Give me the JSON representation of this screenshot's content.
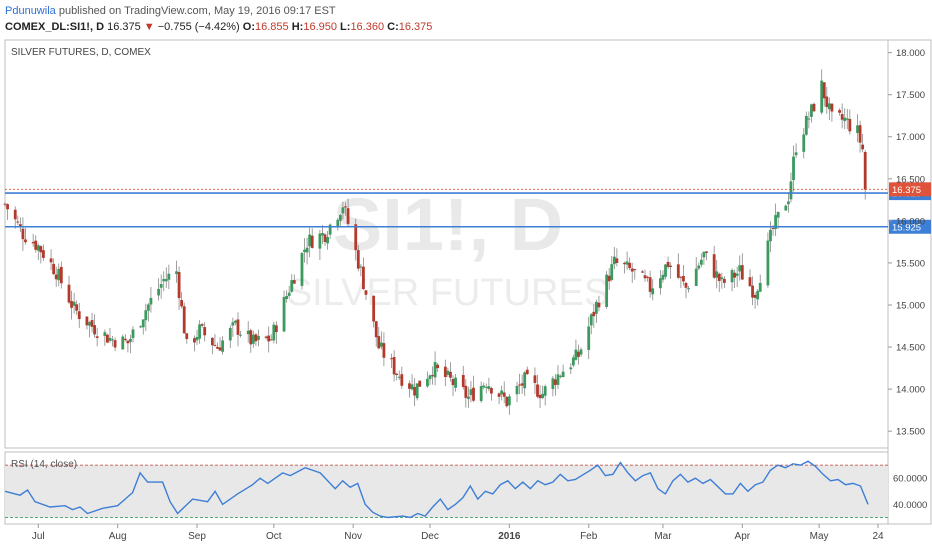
{
  "header": {
    "author": "Pdunuwila",
    "published": "published on TradingView.com, May 19, 2016 09:17 EST",
    "symbol": "COMEX_DL:SI1!, D",
    "last": "16.375",
    "change_arrow": "▼",
    "change": "−0.755 (−4.42%)",
    "o_label": "O:",
    "o_value": "16.855",
    "h_label": "H:",
    "h_value": "16.950",
    "l_label": "L:",
    "l_value": "16.360",
    "c_label": "C:",
    "c_value": "16.375"
  },
  "colors": {
    "up": "#3c9a5f",
    "down": "#b23a2c",
    "level_line": "#3d7ed6",
    "rsi_line": "#3d7ed6",
    "last_price": "#e0533b"
  },
  "chart_data": [
    {
      "type": "candlestick",
      "title": "SILVER FUTURES, D, COMEX",
      "watermark_symbol": "SI1!, D",
      "watermark_name": "SILVER FUTURES",
      "ylim": [
        13.3,
        18.15
      ],
      "yticks": [
        "13.500",
        "14.000",
        "14.500",
        "15.000",
        "15.500",
        "16.000",
        "16.500",
        "17.000",
        "17.500",
        "18.000"
      ],
      "xticks": [
        "Jul",
        "Aug",
        "Sep",
        "Oct",
        "Nov",
        "Dec",
        "2016",
        "Feb",
        "Mar",
        "Apr",
        "May",
        "24"
      ],
      "x_range": [
        "2015-06-18",
        "2016-05-24"
      ],
      "levels": [
        {
          "label": "16.325",
          "value": 16.33
        },
        {
          "label": "15.925",
          "value": 15.93
        }
      ],
      "last_price": {
        "label": "16.375",
        "value": 16.375
      },
      "close_path": [
        [
          "2015-06-18",
          16.2
        ],
        [
          "2015-06-25",
          15.85
        ],
        [
          "2015-07-01",
          15.7
        ],
        [
          "2015-07-08",
          15.4
        ],
        [
          "2015-07-15",
          14.95
        ],
        [
          "2015-07-22",
          14.75
        ],
        [
          "2015-07-29",
          14.6
        ],
        [
          "2015-08-05",
          14.55
        ],
        [
          "2015-08-12",
          14.95
        ],
        [
          "2015-08-19",
          15.3
        ],
        [
          "2015-08-24",
          15.4
        ],
        [
          "2015-08-28",
          14.5
        ],
        [
          "2015-09-02",
          14.7
        ],
        [
          "2015-09-09",
          14.5
        ],
        [
          "2015-09-16",
          14.75
        ],
        [
          "2015-09-23",
          14.55
        ],
        [
          "2015-09-30",
          14.6
        ],
        [
          "2015-10-07",
          15.2
        ],
        [
          "2015-10-14",
          15.75
        ],
        [
          "2015-10-21",
          15.85
        ],
        [
          "2015-10-28",
          16.2
        ],
        [
          "2015-11-04",
          15.4
        ],
        [
          "2015-11-11",
          14.5
        ],
        [
          "2015-11-18",
          14.2
        ],
        [
          "2015-11-25",
          14.0
        ],
        [
          "2015-12-02",
          14.25
        ],
        [
          "2015-12-09",
          14.1
        ],
        [
          "2015-12-16",
          13.9
        ],
        [
          "2015-12-23",
          14.1
        ],
        [
          "2015-12-31",
          13.85
        ],
        [
          "2016-01-07",
          14.1
        ],
        [
          "2016-01-14",
          13.95
        ],
        [
          "2016-01-21",
          14.2
        ],
        [
          "2016-01-28",
          14.4
        ],
        [
          "2016-02-04",
          15.0
        ],
        [
          "2016-02-11",
          15.5
        ],
        [
          "2016-02-18",
          15.4
        ],
        [
          "2016-02-25",
          15.2
        ],
        [
          "2016-03-03",
          15.5
        ],
        [
          "2016-03-10",
          15.2
        ],
        [
          "2016-03-17",
          15.6
        ],
        [
          "2016-03-24",
          15.25
        ],
        [
          "2016-03-31",
          15.4
        ],
        [
          "2016-04-06",
          15.15
        ],
        [
          "2016-04-13",
          15.9
        ],
        [
          "2016-04-19",
          16.3
        ],
        [
          "2016-04-22",
          16.9
        ],
        [
          "2016-04-28",
          17.3
        ],
        [
          "2016-05-02",
          17.6
        ],
        [
          "2016-05-06",
          17.2
        ],
        [
          "2016-05-11",
          17.2
        ],
        [
          "2016-05-16",
          17.05
        ],
        [
          "2016-05-18",
          16.85
        ],
        [
          "2016-05-19",
          16.375
        ]
      ],
      "volatility": 0.13
    },
    {
      "type": "line",
      "title": "RSI (14, close)",
      "ylim": [
        25,
        80
      ],
      "yticks": [
        "40.0000",
        "60.0000"
      ],
      "bands": [
        70,
        30
      ],
      "series": [
        {
          "values": [
            [
              0,
              50
            ],
            [
              2,
              47
            ],
            [
              3,
              51
            ],
            [
              4,
              42
            ],
            [
              6,
              38
            ],
            [
              8,
              39
            ],
            [
              9,
              36
            ],
            [
              10,
              38
            ],
            [
              11,
              33
            ],
            [
              13,
              37
            ],
            [
              15,
              39
            ],
            [
              17,
              49
            ],
            [
              18,
              64
            ],
            [
              19,
              57
            ],
            [
              21,
              57
            ],
            [
              22,
              42
            ],
            [
              23,
              33
            ],
            [
              25,
              44
            ],
            [
              27,
              42
            ],
            [
              28,
              50
            ],
            [
              29,
              40
            ],
            [
              31,
              48
            ],
            [
              33,
              55
            ],
            [
              34,
              60
            ],
            [
              35,
              56
            ],
            [
              37,
              64
            ],
            [
              38,
              62
            ],
            [
              40,
              68
            ],
            [
              42,
              64
            ],
            [
              44,
              52
            ],
            [
              45,
              58
            ],
            [
              46,
              53
            ],
            [
              47,
              56
            ],
            [
              48,
              40
            ],
            [
              49,
              34
            ],
            [
              50,
              31
            ],
            [
              51,
              30
            ],
            [
              53,
              31
            ],
            [
              54,
              30
            ],
            [
              55,
              33
            ],
            [
              56,
              31
            ],
            [
              57,
              38
            ],
            [
              58,
              44
            ],
            [
              59,
              36
            ],
            [
              60,
              40
            ],
            [
              61,
              45
            ],
            [
              62,
              54
            ],
            [
              63,
              44
            ],
            [
              64,
              50
            ],
            [
              65,
              48
            ],
            [
              66,
              55
            ],
            [
              67,
              58
            ],
            [
              68,
              52
            ],
            [
              69,
              57
            ],
            [
              70,
              52
            ],
            [
              71,
              58
            ],
            [
              72,
              55
            ],
            [
              73,
              57
            ],
            [
              74,
              63
            ],
            [
              75,
              58
            ],
            [
              76,
              59
            ],
            [
              78,
              66
            ],
            [
              79,
              70
            ],
            [
              80,
              62
            ],
            [
              81,
              63
            ],
            [
              82,
              72
            ],
            [
              83,
              64
            ],
            [
              84,
              58
            ],
            [
              85,
              62
            ],
            [
              86,
              64
            ],
            [
              87,
              52
            ],
            [
              88,
              48
            ],
            [
              89,
              58
            ],
            [
              90,
              63
            ],
            [
              91,
              57
            ],
            [
              92,
              60
            ],
            [
              93,
              56
            ],
            [
              94,
              59
            ],
            [
              96,
              48
            ],
            [
              97,
              48
            ],
            [
              98,
              56
            ],
            [
              99,
              50
            ],
            [
              100,
              55
            ],
            [
              101,
              57
            ],
            [
              102,
              66
            ],
            [
              103,
              70
            ],
            [
              104,
              68
            ],
            [
              105,
              71
            ],
            [
              106,
              70
            ],
            [
              107,
              73
            ],
            [
              108,
              69
            ],
            [
              109,
              63
            ],
            [
              110,
              58
            ],
            [
              111,
              59
            ],
            [
              112,
              55
            ],
            [
              113,
              56
            ],
            [
              114,
              54
            ],
            [
              115,
              40
            ]
          ]
        }
      ]
    }
  ]
}
